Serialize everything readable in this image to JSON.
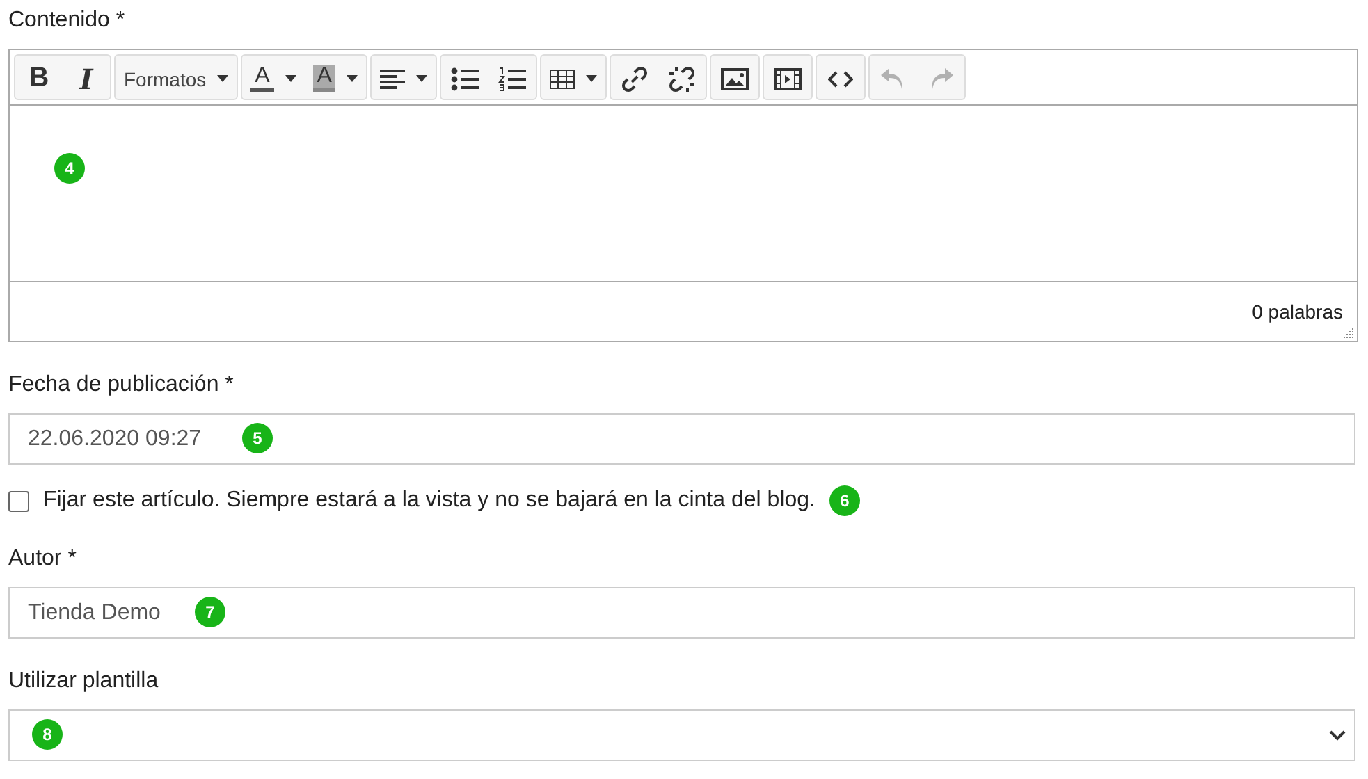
{
  "content_field": {
    "label": "Contenido *",
    "toolbar": [
      {
        "buttons": [
          {
            "kind": "bold",
            "label": "B",
            "disabled": false
          },
          {
            "kind": "italic",
            "label": "I",
            "disabled": false
          }
        ]
      },
      {
        "buttons": [
          {
            "kind": "formats",
            "label": "Formatos",
            "disabled": false
          }
        ]
      },
      {
        "buttons": [
          {
            "kind": "text_color",
            "label": "A",
            "disabled": false
          },
          {
            "kind": "bg_color",
            "label": "A",
            "disabled": false
          }
        ]
      },
      {
        "buttons": [
          {
            "kind": "align",
            "disabled": false
          }
        ]
      },
      {
        "buttons": [
          {
            "kind": "bullet_list",
            "disabled": false
          },
          {
            "kind": "numbered_list",
            "disabled": false
          }
        ]
      },
      {
        "buttons": [
          {
            "kind": "table",
            "disabled": false
          }
        ]
      },
      {
        "buttons": [
          {
            "kind": "link",
            "disabled": false
          },
          {
            "kind": "unlink",
            "disabled": false
          }
        ]
      },
      {
        "buttons": [
          {
            "kind": "image",
            "disabled": false
          }
        ]
      },
      {
        "buttons": [
          {
            "kind": "video",
            "disabled": false
          }
        ]
      },
      {
        "buttons": [
          {
            "kind": "code",
            "disabled": false
          }
        ]
      },
      {
        "buttons": [
          {
            "kind": "undo",
            "disabled": true
          },
          {
            "kind": "redo",
            "disabled": true
          }
        ]
      }
    ],
    "badge": "4",
    "word_count": "0 palabras"
  },
  "publish_date": {
    "label": "Fecha de publicación *",
    "value": "22.06.2020 09:27",
    "badge": "5"
  },
  "pin_checkbox": {
    "label": "Fijar este artículo. Siempre estará a la vista y no se bajará en la cinta del blog.",
    "checked": false,
    "badge": "6"
  },
  "author": {
    "label": "Autor *",
    "value": "Tienda Demo",
    "badge": "7"
  },
  "template": {
    "label": "Utilizar plantilla",
    "badge": "8"
  }
}
